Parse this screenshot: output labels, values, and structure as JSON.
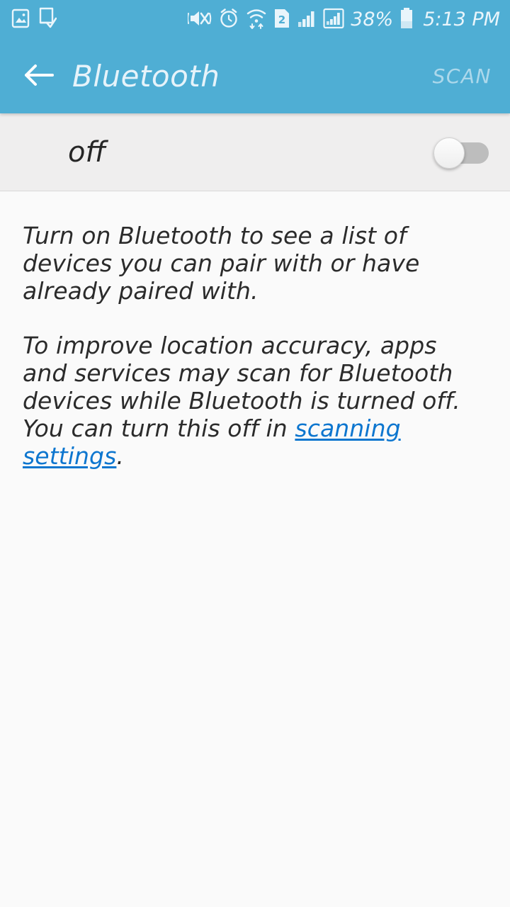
{
  "status_bar": {
    "left_icons": [
      {
        "name": "screenshot-image-icon",
        "label": "screenshot captured"
      },
      {
        "name": "download-complete-icon",
        "label": "download complete"
      }
    ],
    "right_icons": [
      {
        "name": "volume-mute-vibrate-icon",
        "label": "sound muted, vibrate"
      },
      {
        "name": "alarm-clock-icon",
        "label": "alarm set"
      },
      {
        "name": "wifi-data-transfer-icon",
        "label": "wi-fi connected"
      },
      {
        "name": "sim-card-2-icon",
        "label": "SIM 2",
        "text": "2"
      },
      {
        "name": "cellular-signal-icon",
        "label": "signal bars"
      },
      {
        "name": "cellular-signal-boxed-icon",
        "label": "signal bars sim 2"
      }
    ],
    "battery_percent": "38%",
    "battery_level": 38,
    "clock": "5:13 PM"
  },
  "app_bar": {
    "back_label": "Back",
    "title": "Bluetooth",
    "action_label": "SCAN",
    "action_enabled": false
  },
  "toggle": {
    "state_label": "off",
    "checked": false
  },
  "content": {
    "paragraph1": "Turn on Bluetooth to see a list of devices you can pair with or have already paired with.",
    "paragraph2_before": "To improve location accuracy, apps and services may scan for Bluetooth devices while Bluetooth is turned off. You can turn this off in ",
    "paragraph2_link": "scanning settings",
    "paragraph2_after": "."
  },
  "colors": {
    "header_blue": "#4faed4",
    "toggle_row_bg": "#efeeee",
    "content_bg": "#fafafa",
    "link_blue": "#0d76cf",
    "text_dark": "#2b2b2b",
    "switch_track_off": "#bdbdbd"
  }
}
